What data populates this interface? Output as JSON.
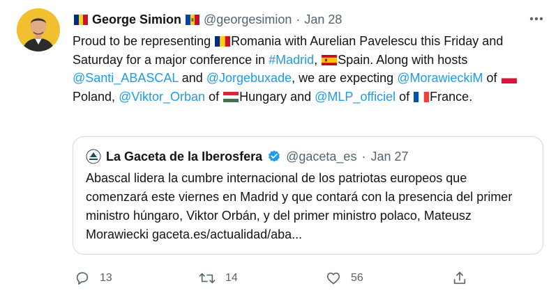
{
  "author": {
    "name": "George Simion",
    "handle": "@georgesimion",
    "separator": "·",
    "date": "Jan 28"
  },
  "tweet": {
    "t1": "Proud to be representing ",
    "t2": "Romania with Aurelian Pavelescu this Friday and Saturday for a major conference in ",
    "hashtag": "#Madrid",
    "t3": ", ",
    "t4": "Spain. Along with hosts ",
    "mention1": "@Santi_ABASCAL",
    "t5": " and ",
    "mention2": "@Jorgebuxade",
    "t6": ", we are expecting ",
    "mention3": "@MorawieckiM",
    "t7": " of ",
    "t8": "Poland, ",
    "mention4": "@Viktor_Orban",
    "t9": " of ",
    "t10": "Hungary and ",
    "mention5": "@MLP_officiel",
    "t11": " of ",
    "t12": "France."
  },
  "quote": {
    "name": "La Gaceta de la Iberosfera",
    "handle": "@gaceta_es",
    "separator": "·",
    "date": "Jan 27",
    "text": "Abascal lidera la cumbre internacional de los patriotas europeos que comenzará este viernes en Madrid y que contará con la presencia del primer ministro húngaro, Viktor Orbán, y del primer ministro polaco, Mateusz Morawiecki gaceta.es/actualidad/aba..."
  },
  "actions": {
    "replies": "13",
    "retweets": "14",
    "likes": "56"
  },
  "colors": {
    "link": "#1d9bf0",
    "muted": "#536471",
    "border": "#cfd9de",
    "verified": "#1d9bf0"
  },
  "icons": [
    "more-icon",
    "reply-icon",
    "retweet-icon",
    "like-icon",
    "share-icon",
    "verified-badge-icon"
  ]
}
